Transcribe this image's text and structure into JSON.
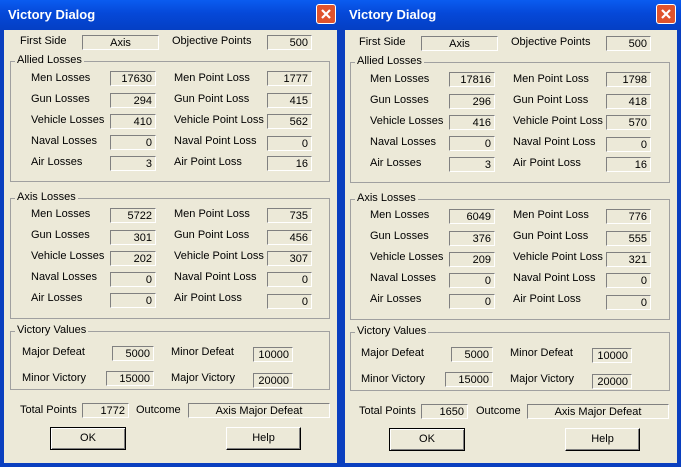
{
  "dialogs": [
    {
      "title": "Victory Dialog",
      "first_side_label": "First Side",
      "first_side": "Axis",
      "objective_points_label": "Objective Points",
      "objective_points": "500",
      "allied_group": "Allied Losses",
      "allied": {
        "men_label": "Men Losses",
        "men": "17630",
        "men_pts_label": "Men Point Loss",
        "men_pts": "1777",
        "gun_label": "Gun Losses",
        "gun": "294",
        "gun_pts_label": "Gun Point Loss",
        "gun_pts": "415",
        "veh_label": "Vehicle Losses",
        "veh": "410",
        "veh_pts_label": "Vehicle Point Loss",
        "veh_pts": "562",
        "nav_label": "Naval Losses",
        "nav": "0",
        "nav_pts_label": "Naval Point Loss",
        "nav_pts": "0",
        "air_label": "Air Losses",
        "air": "3",
        "air_pts_label": "Air Point Loss",
        "air_pts": "16"
      },
      "axis_group": "Axis Losses",
      "axis": {
        "men_label": "Men Losses",
        "men": "5722",
        "men_pts_label": "Men Point Loss",
        "men_pts": "735",
        "gun_label": "Gun Losses",
        "gun": "301",
        "gun_pts_label": "Gun Point Loss",
        "gun_pts": "456",
        "veh_label": "Vehicle Losses",
        "veh": "202",
        "veh_pts_label": "Vehicle Point Loss",
        "veh_pts": "307",
        "nav_label": "Naval Losses",
        "nav": "0",
        "nav_pts_label": "Naval Point Loss",
        "nav_pts": "0",
        "air_label": "Air Losses",
        "air": "0",
        "air_pts_label": "Air Point Loss",
        "air_pts": "0"
      },
      "vv_group": "Victory Values",
      "vv": {
        "maj_def_label": "Major Defeat",
        "maj_def": "5000",
        "min_def_label": "Minor Defeat",
        "min_def": "10000",
        "min_vic_label": "Minor Victory",
        "min_vic": "15000",
        "maj_vic_label": "Major Victory",
        "maj_vic": "20000"
      },
      "total_label": "Total Points",
      "total": "1772",
      "outcome_label": "Outcome",
      "outcome": "Axis Major Defeat",
      "ok_label": "OK",
      "help_label": "Help"
    },
    {
      "title": "Victory Dialog",
      "first_side_label": "First Side",
      "first_side": "Axis",
      "objective_points_label": "Objective Points",
      "objective_points": "500",
      "allied_group": "Allied Losses",
      "allied": {
        "men_label": "Men Losses",
        "men": "17816",
        "men_pts_label": "Men Point Loss",
        "men_pts": "1798",
        "gun_label": "Gun Losses",
        "gun": "296",
        "gun_pts_label": "Gun Point Loss",
        "gun_pts": "418",
        "veh_label": "Vehicle Losses",
        "veh": "416",
        "veh_pts_label": "Vehicle Point Loss",
        "veh_pts": "570",
        "nav_label": "Naval Losses",
        "nav": "0",
        "nav_pts_label": "Naval Point Loss",
        "nav_pts": "0",
        "air_label": "Air Losses",
        "air": "3",
        "air_pts_label": "Air Point Loss",
        "air_pts": "16"
      },
      "axis_group": "Axis Losses",
      "axis": {
        "men_label": "Men Losses",
        "men": "6049",
        "men_pts_label": "Men Point Loss",
        "men_pts": "776",
        "gun_label": "Gun Losses",
        "gun": "376",
        "gun_pts_label": "Gun Point Loss",
        "gun_pts": "555",
        "veh_label": "Vehicle Losses",
        "veh": "209",
        "veh_pts_label": "Vehicle Point Loss",
        "veh_pts": "321",
        "nav_label": "Naval Losses",
        "nav": "0",
        "nav_pts_label": "Naval Point Loss",
        "nav_pts": "0",
        "air_label": "Air Losses",
        "air": "0",
        "air_pts_label": "Air Point Loss",
        "air_pts": "0"
      },
      "vv_group": "Victory Values",
      "vv": {
        "maj_def_label": "Major Defeat",
        "maj_def": "5000",
        "min_def_label": "Minor Defeat",
        "min_def": "10000",
        "min_vic_label": "Minor Victory",
        "min_vic": "15000",
        "maj_vic_label": "Major Victory",
        "maj_vic": "20000"
      },
      "total_label": "Total Points",
      "total": "1650",
      "outcome_label": "Outcome",
      "outcome": "Axis Major Defeat",
      "ok_label": "OK",
      "help_label": "Help"
    }
  ]
}
